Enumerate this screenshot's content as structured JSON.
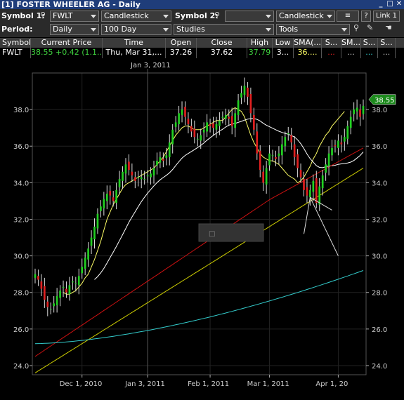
{
  "window": {
    "title": "[1] FOSTER WHEELER AG - Daily"
  },
  "toolbar": {
    "symbol1_label": "Symbol 1:",
    "symbol1_value": "FWLT",
    "chart_type_1": "Candlestick",
    "symbol2_label": "Symbol 2:",
    "symbol2_value": "",
    "chart_type_2": "Candlestick",
    "help_label": "?",
    "link_label": "Link 1",
    "period_label": "Period:",
    "period_value": "Daily",
    "range_value": "100 Day",
    "studies_value": "Studies",
    "tools_value": "Tools"
  },
  "quote": {
    "headers": [
      "Symbol",
      "Current Price",
      "Time",
      "Open",
      "Close",
      "High",
      "Low",
      "SMA(...",
      "S...",
      "SM...",
      "S...",
      "S..."
    ],
    "symbol": "FWLT",
    "current_price": "38.55",
    "change": "+0.42 (1.1...",
    "time": "Thu, Mar 31,...",
    "open": "37.26",
    "close": "37.62",
    "high": "37.79",
    "low": "3...",
    "sma1": "36....",
    "sma2": "...",
    "sma3": "...",
    "sma4": "...",
    "sma5": "..."
  },
  "chart_data": {
    "type": "candlestick",
    "symbol": "FWLT",
    "period": "Daily",
    "range": "100 Day",
    "crosshair_label": "Jan 3, 2011",
    "last_price_label": "38.55",
    "ylim": [
      23.5,
      40.0
    ],
    "yticks": [
      24.0,
      26.0,
      28.0,
      30.0,
      32.0,
      34.0,
      36.0,
      38.0
    ],
    "ytick_labels": [
      "24.0",
      "26.0",
      "28.0",
      "30.0",
      "32.0",
      "34.0",
      "36.0",
      "38.0"
    ],
    "xtick_labels": [
      {
        "label": "Dec 1, 2010",
        "index": 15
      },
      {
        "label": "Jan 3, 2011",
        "index": 36
      },
      {
        "label": "Feb 1, 2011",
        "index": 56
      },
      {
        "label": "Mar 1, 2011",
        "index": 75
      },
      {
        "label": "Apr 1, 20",
        "index": 97
      }
    ],
    "grid": true,
    "colors": {
      "up": "#22d022",
      "down": "#e02020",
      "sma_a": "#ffff66",
      "sma_b": "#ffffff",
      "sma_c": "#cc1111",
      "sma_d": "#cccc00",
      "sma_e": "#33cccc",
      "price_tag": "#1c8a1c"
    },
    "closes": [
      29.0,
      28.7,
      28.2,
      27.6,
      27.2,
      27.1,
      27.4,
      27.8,
      28.1,
      28.3,
      28.0,
      28.4,
      28.6,
      28.5,
      28.9,
      29.4,
      29.9,
      30.4,
      31.0,
      31.6,
      32.3,
      32.7,
      33.1,
      33.4,
      33.3,
      33.0,
      33.6,
      34.2,
      34.6,
      35.0,
      34.7,
      34.4,
      34.1,
      34.3,
      34.3,
      34.2,
      34.4,
      34.5,
      34.8,
      35.2,
      35.4,
      35.2,
      35.5,
      36.2,
      36.9,
      37.3,
      37.8,
      38.0,
      37.6,
      37.2,
      36.8,
      36.5,
      36.4,
      36.6,
      36.9,
      37.3,
      37.1,
      37.0,
      37.2,
      37.4,
      37.6,
      37.7,
      37.5,
      37.1,
      37.8,
      38.5,
      38.9,
      39.3,
      38.7,
      37.8,
      36.9,
      35.6,
      34.7,
      34.0,
      34.8,
      35.6,
      35.5,
      35.3,
      35.6,
      36.1,
      36.5,
      36.7,
      36.2,
      35.4,
      34.8,
      34.3,
      33.6,
      33.3,
      33.6,
      34.1,
      32.9,
      33.8,
      34.4,
      35.0,
      35.6,
      35.9,
      36.0,
      36.3,
      36.1,
      36.5,
      37.1,
      37.6,
      38.0,
      38.1,
      37.6,
      38.2
    ],
    "series": [
      {
        "name": "SMA(10)",
        "color": "#ffff66",
        "values": [
          null,
          null,
          null,
          null,
          null,
          null,
          null,
          null,
          null,
          28.0,
          27.9,
          27.9,
          28.0,
          28.1,
          28.3,
          28.5,
          28.8,
          29.0,
          29.4,
          29.8,
          30.3,
          30.8,
          31.4,
          32.0,
          32.4,
          32.8,
          33.1,
          33.4,
          33.7,
          33.9,
          34.0,
          34.1,
          34.2,
          34.3,
          34.4,
          34.5,
          34.6,
          34.7,
          34.8,
          35.0,
          35.2,
          35.4,
          35.7,
          36.0,
          36.3,
          36.6,
          36.8,
          37.0,
          37.1,
          37.1,
          37.0,
          36.9,
          36.9,
          36.9,
          37.0,
          37.1,
          37.2,
          37.3,
          37.4,
          37.4,
          37.4,
          37.6,
          37.8,
          38.0,
          38.1,
          38.0,
          37.9,
          37.6,
          37.1,
          36.6,
          36.2,
          35.9,
          35.6,
          35.4,
          35.3,
          35.2,
          35.2,
          35.1,
          35.0,
          34.8,
          34.6,
          34.4,
          34.3,
          34.2,
          34.0,
          34.1,
          34.3,
          34.6,
          34.9,
          35.3,
          35.6,
          36.0,
          36.3,
          36.6,
          36.8,
          37.1,
          37.3,
          37.5,
          37.7,
          37.9
        ]
      }
    ]
  }
}
